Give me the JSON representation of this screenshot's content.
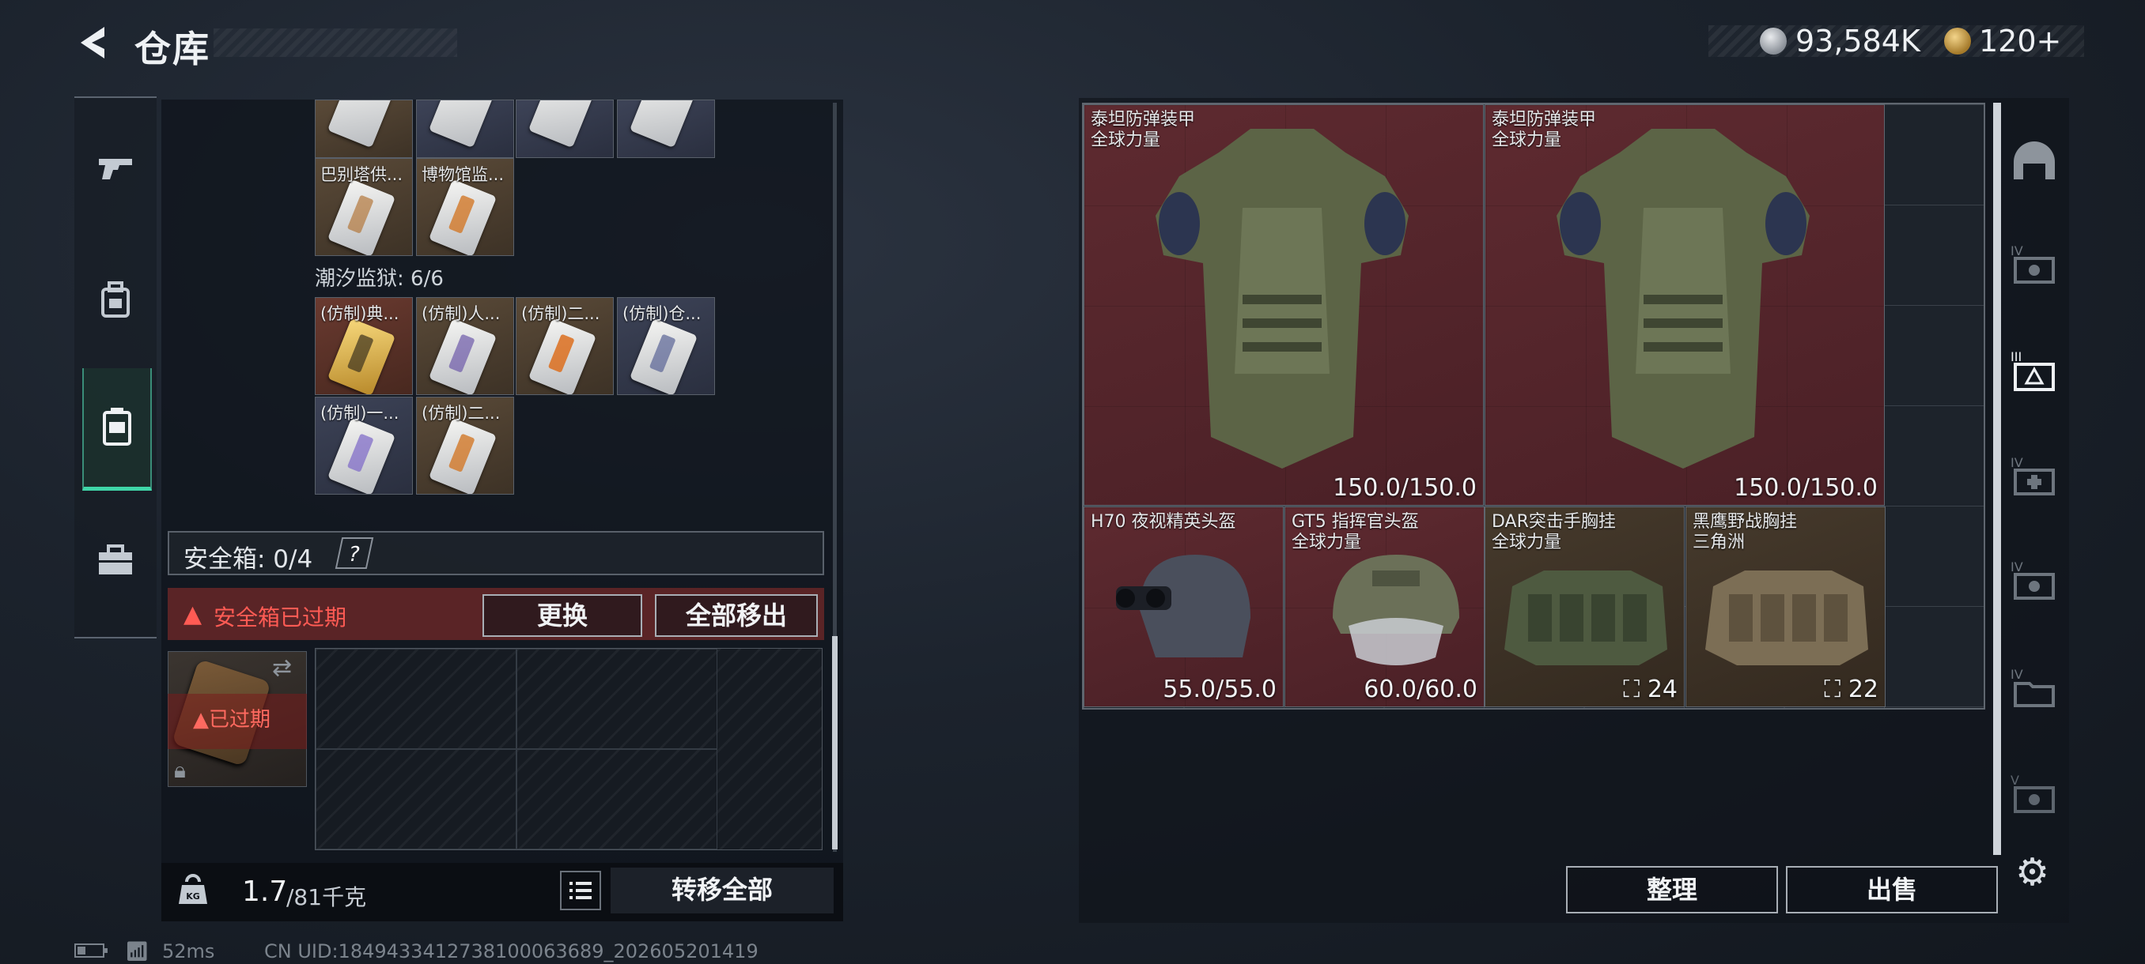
{
  "header": {
    "title": "仓库",
    "currency_1": "93,584K",
    "currency_2": "120+"
  },
  "left_rail": {
    "items": [
      {
        "name": "weapon",
        "icon": "gun-icon"
      },
      {
        "name": "equipment",
        "icon": "backpack-icon"
      },
      {
        "name": "collectibles",
        "icon": "card-icon",
        "active": true
      },
      {
        "name": "tools",
        "icon": "toolbox-icon"
      }
    ]
  },
  "stash": {
    "top_row_items": [
      "",
      "",
      "",
      ""
    ],
    "row2_items": [
      "巴别塔供...",
      "博物馆监..."
    ],
    "section_title": "潮汐监狱: 6/6",
    "section_items_row1": [
      "(仿制)典...",
      "(仿制)人...",
      "(仿制)二...",
      "(仿制)仓..."
    ],
    "section_items_row2": [
      "(仿制)一...",
      "(仿制)二..."
    ],
    "safe_box_label": "安全箱: 0/4",
    "help": "?",
    "warning_text": "安全箱已过期",
    "replace_button": "更换",
    "move_all_button": "全部移出",
    "case_expired": "已过期",
    "weight_value": "1.7",
    "weight_max": "/81千克",
    "transfer_all_button": "转移全部"
  },
  "inventory": {
    "items": [
      {
        "name": "泰坦防弹装甲",
        "sub": "全球力量",
        "durability": "150.0/150.0"
      },
      {
        "name": "泰坦防弹装甲",
        "sub": "全球力量",
        "durability": "150.0/150.0"
      },
      {
        "name": "H70 夜视精英头盔",
        "sub": "",
        "durability": "55.0/55.0"
      },
      {
        "name": "GT5 指挥官头盔",
        "sub": "全球力量",
        "durability": "60.0/60.0"
      },
      {
        "name": "DAR突击手胸挂",
        "sub": "全球力量",
        "count": "24"
      },
      {
        "name": "黑鹰野战胸挂",
        "sub": "三角洲",
        "count": "22"
      }
    ],
    "sort_button": "整理",
    "sell_button": "出售"
  },
  "side_tabs": [
    "helmet-tab",
    "IV",
    "III",
    "IV",
    "IV",
    "IV",
    "V"
  ],
  "status_bar": {
    "ping": "52ms",
    "uid": "CN UID:1849433412738100063689_202605201419"
  },
  "colors": {
    "accent": "#3fd6a8",
    "warning": "#ff5b54",
    "armor_bg": "#5e2a30"
  }
}
